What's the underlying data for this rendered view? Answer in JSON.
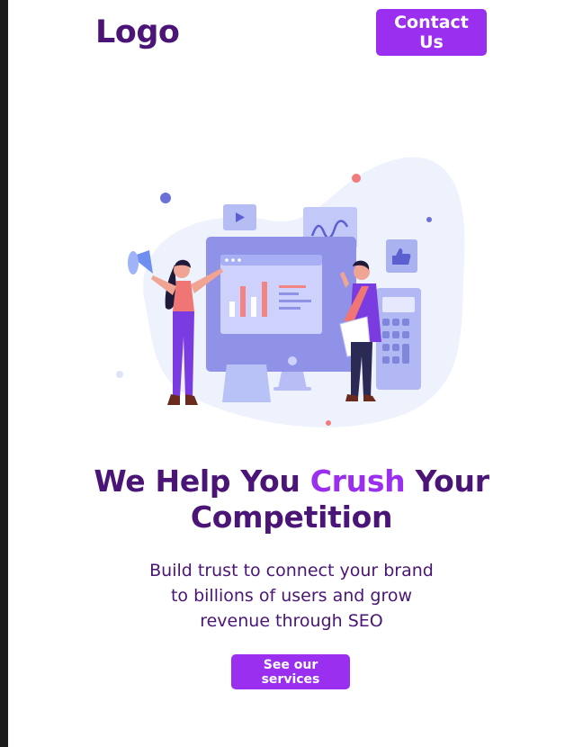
{
  "header": {
    "logo": "Logo",
    "contact_label": "Contact Us"
  },
  "hero": {
    "headline_part1": "We Help You ",
    "headline_accent": "Crush",
    "headline_part2": " Your Competition",
    "subtext": "Build trust to connect your brand to billions of users and grow revenue through SEO",
    "cta_label": "See our services"
  },
  "colors": {
    "brand_dark": "#4a1576",
    "brand_accent": "#9a2ff0",
    "background": "#ffffff"
  }
}
